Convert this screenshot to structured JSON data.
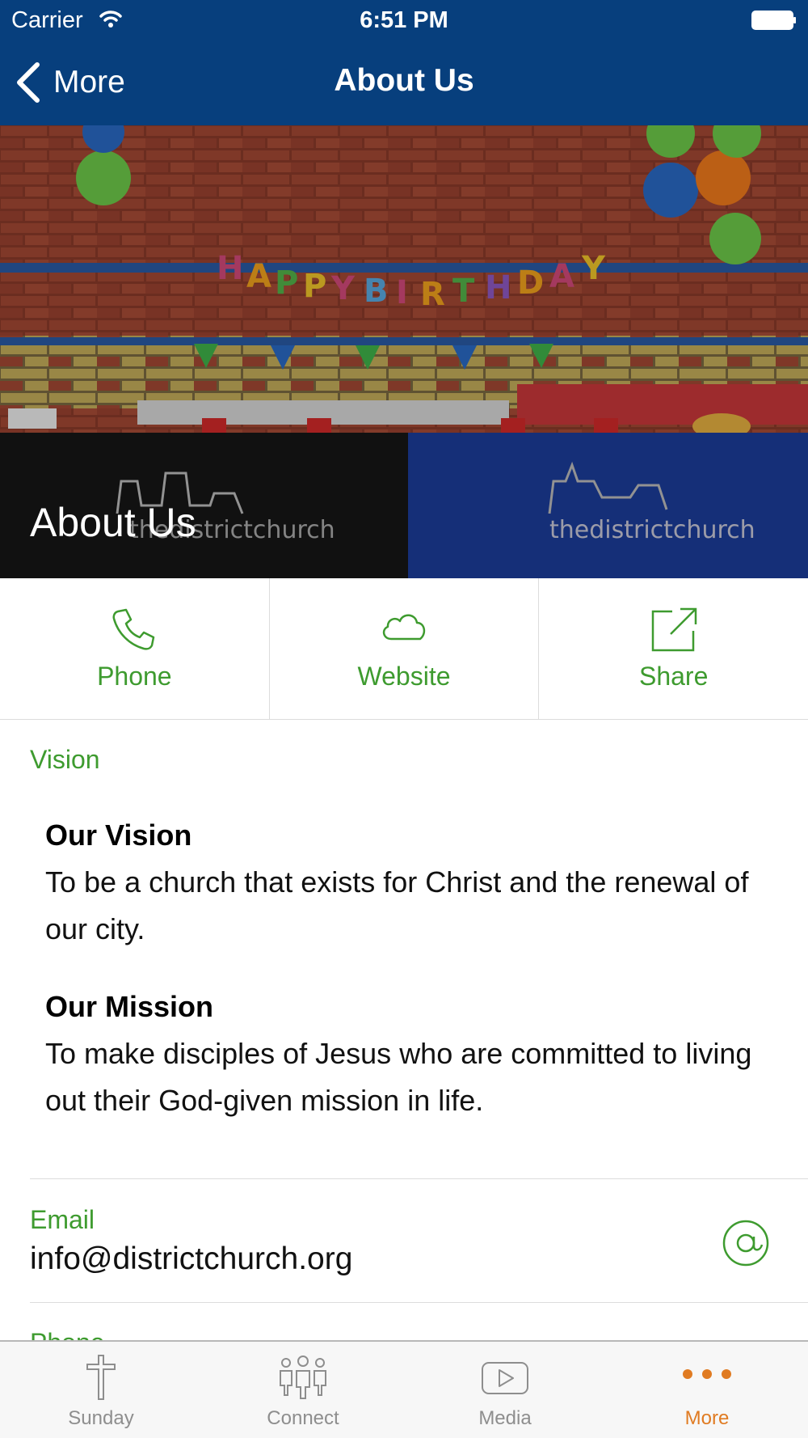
{
  "status_bar": {
    "carrier": "Carrier",
    "time": "6:51 PM"
  },
  "nav": {
    "back_label": "More",
    "title": "About Us"
  },
  "hero": {
    "title": "About Us"
  },
  "actions": [
    {
      "label": "Phone",
      "icon": "phone-icon"
    },
    {
      "label": "Website",
      "icon": "cloud-icon"
    },
    {
      "label": "Share",
      "icon": "share-icon"
    }
  ],
  "vision": {
    "section_label": "Vision",
    "vision_heading": "Our Vision",
    "vision_text": "To be a church that exists for Christ and the renewal of our city.",
    "mission_heading": "Our Mission",
    "mission_text": "To make disciples of Jesus who are committed to living out their God-given mission in life."
  },
  "email": {
    "label": "Email",
    "value": "info@districtchurch.org",
    "icon": "at-icon"
  },
  "phone": {
    "label": "Phone"
  },
  "tabs": [
    {
      "label": "Sunday",
      "icon": "cross-icon",
      "active": false
    },
    {
      "label": "Connect",
      "icon": "people-icon",
      "active": false
    },
    {
      "label": "Media",
      "icon": "play-icon",
      "active": false
    },
    {
      "label": "More",
      "icon": "more-dots-icon",
      "active": true
    }
  ],
  "colors": {
    "nav_bg": "#073f7d",
    "accent_green": "#3e9b2f",
    "active_tab": "#e07b22",
    "inactive_tab": "#8e8e8e"
  }
}
